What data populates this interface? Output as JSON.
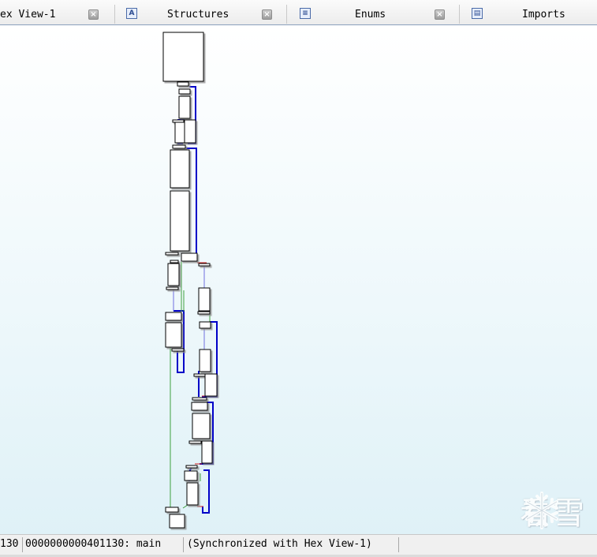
{
  "tabs": [
    {
      "label": "ex View-1",
      "icon": "hex-view-icon",
      "closable": true
    },
    {
      "label": "Structures",
      "icon": "structures-icon",
      "icon_glyph": "A",
      "closable": true
    },
    {
      "label": "Enums",
      "icon": "enums-icon",
      "icon_glyph": "≡",
      "closable": true
    },
    {
      "label": "Imports",
      "icon": "imports-icon",
      "icon_glyph": "▤",
      "closable": false
    }
  ],
  "tab_close_glyph": "×",
  "status": {
    "left_fragment": "130",
    "location_text": "0000000000401130: main",
    "sync_text": "(Synchronized with Hex View-1)"
  },
  "watermark": {
    "text": "看雪",
    "icon": "snowflake-icon"
  },
  "colors": {
    "edge_unconditional": "#0000c8",
    "edge_true": "#3ea03e",
    "edge_false": "#d02020",
    "edge_weak": "#7070e0"
  }
}
